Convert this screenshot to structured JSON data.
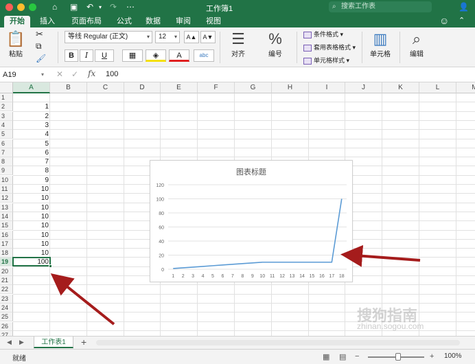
{
  "window": {
    "title": "工作簿1",
    "search_placeholder": "搜索工作表"
  },
  "tabs": [
    {
      "label": "开始",
      "active": true
    },
    {
      "label": "插入"
    },
    {
      "label": "页面布局"
    },
    {
      "label": "公式"
    },
    {
      "label": "数据"
    },
    {
      "label": "审阅"
    },
    {
      "label": "视图"
    }
  ],
  "ribbon": {
    "paste_label": "粘贴",
    "font_name": "等线 Regular (正文)",
    "font_size": "12",
    "bold": "B",
    "italic": "I",
    "underline": "U",
    "increase_font": "A▲",
    "decrease_font": "A▼",
    "align_label": "对齐",
    "number_label": "编号",
    "cond_format": "条件格式",
    "table_format": "套用表格格式",
    "cell_style": "单元格样式",
    "cells_label": "单元格",
    "edit_label": "编辑"
  },
  "formula_bar": {
    "name_box": "A19",
    "value": "100"
  },
  "columns": [
    "A",
    "B",
    "C",
    "D",
    "E",
    "F",
    "G",
    "H",
    "I",
    "J",
    "K",
    "L",
    "M"
  ],
  "rows": [
    "1",
    "2",
    "3",
    "4",
    "5",
    "6",
    "7",
    "8",
    "9",
    "10",
    "11",
    "12",
    "13",
    "14",
    "15",
    "16",
    "17",
    "18",
    "19",
    "20",
    "21",
    "22",
    "23",
    "24",
    "25",
    "26",
    "27"
  ],
  "column_a_values": [
    "",
    "1",
    "2",
    "3",
    "4",
    "5",
    "6",
    "7",
    "8",
    "9",
    "10",
    "10",
    "10",
    "10",
    "10",
    "10",
    "10",
    "10",
    "100"
  ],
  "selected_cell": {
    "col": "A",
    "row": "19"
  },
  "chart_data": {
    "type": "line",
    "title": "图表标题",
    "x": [
      1,
      2,
      3,
      4,
      5,
      6,
      7,
      8,
      9,
      10,
      11,
      12,
      13,
      14,
      15,
      16,
      17,
      18
    ],
    "series": [
      {
        "values": [
          1,
          2,
          3,
          4,
          5,
          6,
          7,
          8,
          9,
          10,
          10,
          10,
          10,
          10,
          10,
          10,
          10,
          100
        ]
      }
    ],
    "ylim": [
      0,
      120
    ],
    "yticks": [
      0,
      20,
      40,
      60,
      80,
      100,
      120
    ],
    "grid": true,
    "line_color": "#5b9bd5"
  },
  "sheets": [
    {
      "label": "工作表1",
      "active": true
    }
  ],
  "status": {
    "text": "就绪",
    "zoom": "100%"
  },
  "watermark": {
    "line1": "搜狗指南",
    "line2": "zhinan.sogou.com"
  },
  "colors": {
    "accent": "#217346",
    "arrow": "#a51c1c"
  }
}
